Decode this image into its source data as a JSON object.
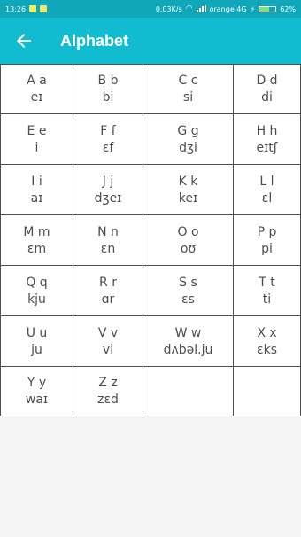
{
  "status_bar": {
    "time": "13:26",
    "speed": "0.03K/s",
    "carrier": "orange 4G",
    "battery_percent": "62%",
    "battery_level": 0.62
  },
  "toolbar": {
    "back_icon": "arrow-left-icon",
    "title": "Alphabet"
  },
  "alphabet": [
    {
      "letter": "A a",
      "ipa": "eɪ"
    },
    {
      "letter": "B b",
      "ipa": "bi"
    },
    {
      "letter": "C c",
      "ipa": "si"
    },
    {
      "letter": "D d",
      "ipa": "di"
    },
    {
      "letter": "E e",
      "ipa": "i"
    },
    {
      "letter": "F f",
      "ipa": "ɛf"
    },
    {
      "letter": "G g",
      "ipa": "dʒi"
    },
    {
      "letter": "H h",
      "ipa": "eɪtʃ"
    },
    {
      "letter": "I i",
      "ipa": "aɪ"
    },
    {
      "letter": "J j",
      "ipa": "dʒeɪ"
    },
    {
      "letter": "K k",
      "ipa": "keɪ"
    },
    {
      "letter": "L l",
      "ipa": "ɛl"
    },
    {
      "letter": "M m",
      "ipa": "ɛm"
    },
    {
      "letter": "N n",
      "ipa": "ɛn"
    },
    {
      "letter": "O o",
      "ipa": "oʊ"
    },
    {
      "letter": "P p",
      "ipa": "pi"
    },
    {
      "letter": "Q q",
      "ipa": "kju"
    },
    {
      "letter": "R r",
      "ipa": "ɑr"
    },
    {
      "letter": "S s",
      "ipa": "ɛs"
    },
    {
      "letter": "T t",
      "ipa": "ti"
    },
    {
      "letter": "U u",
      "ipa": "ju"
    },
    {
      "letter": "V v",
      "ipa": "vi"
    },
    {
      "letter": "W w",
      "ipa": "dʌbəl.ju"
    },
    {
      "letter": "X x",
      "ipa": "ɛks"
    },
    {
      "letter": "Y y",
      "ipa": "waɪ"
    },
    {
      "letter": "Z z",
      "ipa": "zɛd"
    }
  ],
  "colors": {
    "status_bar": "#11a7ba",
    "toolbar": "#12bcd0",
    "grid_line": "#4e4e4e",
    "text": "#4d4d4d",
    "background": "#f5f5f5"
  }
}
